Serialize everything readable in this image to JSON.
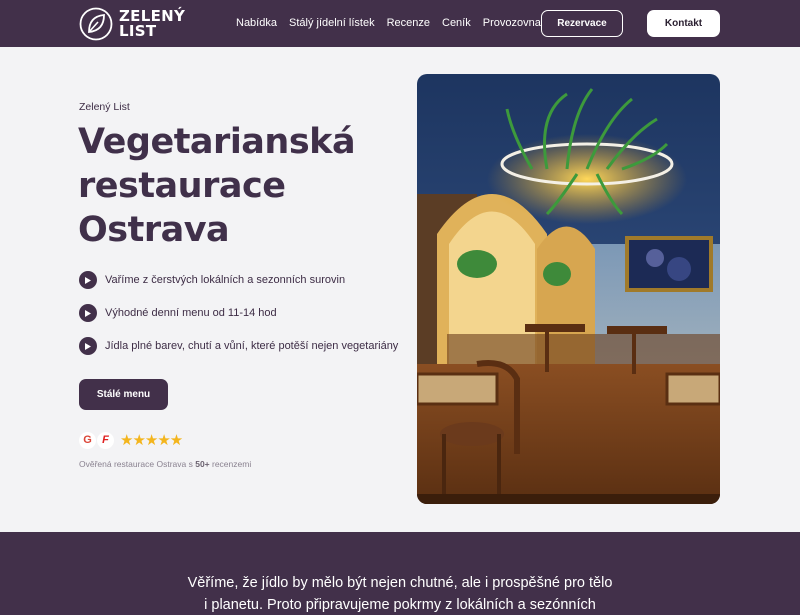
{
  "brand": {
    "name_line1": "ZELENÝ",
    "name_line2": "LIST"
  },
  "nav": [
    "Nabídka",
    "Stálý jídelní lístek",
    "Recenze",
    "Ceník",
    "Provozovna"
  ],
  "header": {
    "reservation_label": "Rezervace",
    "contact_label": "Kontakt"
  },
  "hero": {
    "eyebrow": "Zelený List",
    "title_lines": [
      "Vegetarianská",
      "restaurace",
      "Ostrava"
    ],
    "features": [
      "Vaříme z čerstvých lokálních a sezonních surovin",
      "Výhodné denní menu od 11-14 hod",
      "Jídla plné barev, chutí a vůní, které potěší nejen vegetariány"
    ],
    "menu_button": "Stálé menu",
    "rating": {
      "stars": 5,
      "badge_google": "G",
      "badge_f": "F",
      "note_prefix": "Ověřená restaurace Ostrava s ",
      "note_count": "50+",
      "note_suffix": " recenzemi"
    }
  },
  "band": {
    "text_line1": "Věříme, že jídlo by mělo být nejen chutné, ale i prospěšné pro tělo",
    "text_line2": "i planetu. Proto připravujeme pokrmy z lokálních a sezónních"
  },
  "colors": {
    "primary": "#42304a",
    "stars": "#f3b51d",
    "background": "#f3f3f5"
  },
  "icons": {
    "logo": "leaf-icon",
    "bullet": "play-arrow-icon",
    "photo": "restaurant-interior-image"
  }
}
